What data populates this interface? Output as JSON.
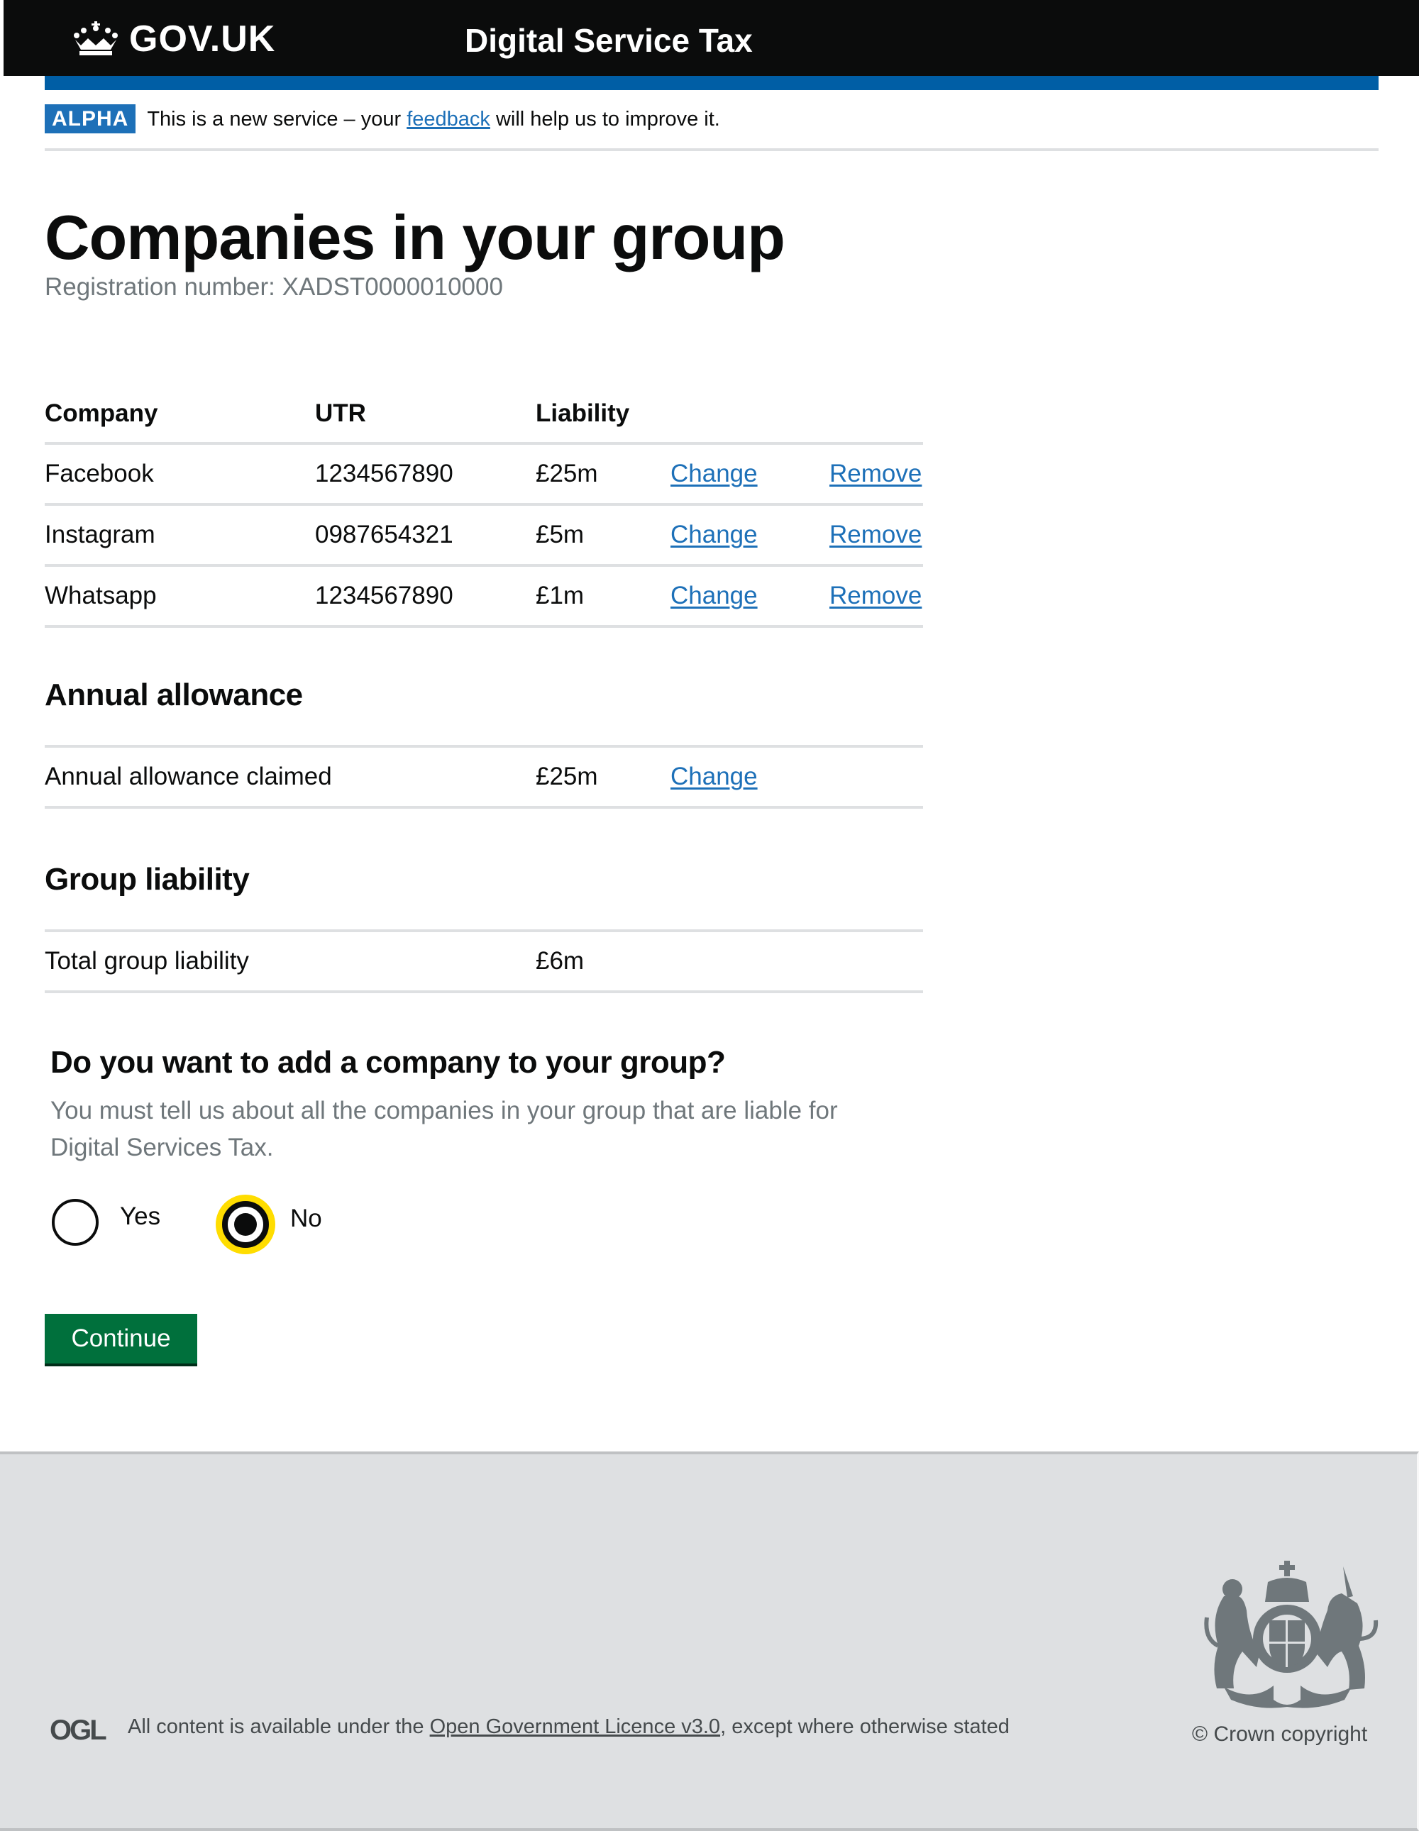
{
  "header": {
    "logo_text": "GOV.UK",
    "service_name": "Digital Service Tax",
    "logo_icon": "crown-icon"
  },
  "phase_banner": {
    "tag": "ALPHA",
    "text_before": "This is a new service – your ",
    "link": "feedback",
    "text_after": " will help us to improve it."
  },
  "page": {
    "title": "Companies in your group",
    "registration_label": "Registration number: XADST0000010000"
  },
  "companies_table": {
    "headers": [
      "Company",
      "UTR",
      "Liability"
    ],
    "rows": [
      {
        "company": "Facebook",
        "utr": "1234567890",
        "liability": "£25m",
        "change": "Change",
        "remove": "Remove"
      },
      {
        "company": "Instagram",
        "utr": "0987654321",
        "liability": "£5m",
        "change": "Change",
        "remove": "Remove"
      },
      {
        "company": "Whatsapp",
        "utr": "1234567890",
        "liability": "£1m",
        "change": "Change",
        "remove": "Remove"
      }
    ]
  },
  "annual_allowance": {
    "heading": "Annual allowance",
    "label": "Annual allowance claimed",
    "value": "£25m",
    "change": "Change"
  },
  "group_liability": {
    "heading": "Group liability",
    "label": "Total group liability",
    "value": "£6m"
  },
  "question": {
    "heading": "Do you want to add a company to your group?",
    "hint": "You must tell us about all the companies in your group that are liable for Digital Services Tax.",
    "options": [
      {
        "label": "Yes",
        "checked": false
      },
      {
        "label": "No",
        "checked": true
      }
    ],
    "selected": "No"
  },
  "continue_button": "Continue",
  "footer": {
    "ogl_logo": "OGL",
    "licence_before": "All content is available under the ",
    "licence_link": "Open Government Licence v3.0",
    "licence_after": ", except where otherwise stated",
    "copyright": "© Crown copyright",
    "crest_icon": "royal-coat-of-arms-icon"
  },
  "colors": {
    "header_bg": "#0b0c0c",
    "brand_blue": "#005ea5",
    "link": "#1d70b8",
    "button_green": "#00703c",
    "focus_yellow": "#ffdd00",
    "footer_bg": "#dee0e2",
    "secondary_text": "#6f777b"
  }
}
